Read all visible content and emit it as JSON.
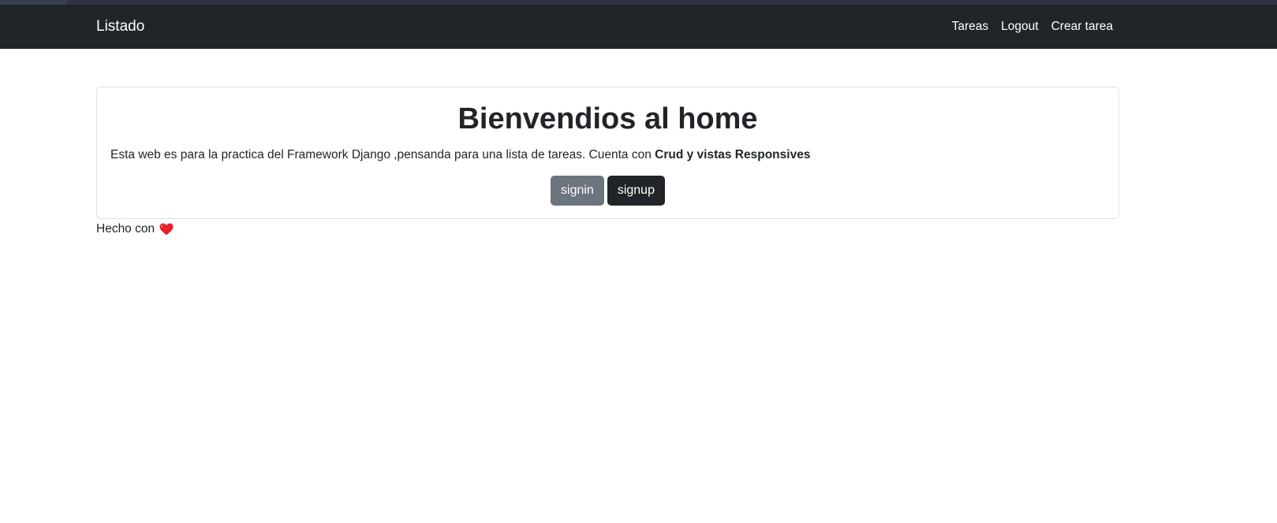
{
  "navbar": {
    "brand": "Listado",
    "links": [
      {
        "label": "Tareas"
      },
      {
        "label": "Logout"
      },
      {
        "label": "Crear tarea"
      }
    ]
  },
  "card": {
    "title": "Bienvendios al home",
    "text_plain": "Esta web es para la practica del Framework Django ,pensanda para una lista de tareas. Cuenta con ",
    "text_bold": "Crud y vistas Responsives",
    "buttons": {
      "signin": "signin",
      "signup": "signup"
    }
  },
  "footer": {
    "text": "Hecho con",
    "icon": "heart-icon",
    "icon_color": "#e8202c"
  },
  "colors": {
    "navbar": "#212529",
    "btn_secondary": "#6c757d",
    "btn_dark": "#212529"
  }
}
